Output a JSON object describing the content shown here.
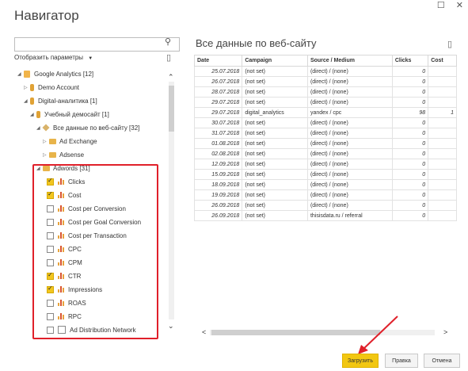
{
  "window": {
    "title": "Навигатор",
    "minimize_glyph": "☐",
    "close_glyph": "✕"
  },
  "left": {
    "search": {
      "value": "",
      "placeholder": ""
    },
    "display_options_label": "Отобразить параметры",
    "tree": [
      {
        "label": "Google Analytics [12]",
        "icon": "google-analytics-icon"
      },
      {
        "label": "Demo Account",
        "icon": "account-icon"
      },
      {
        "label": "Digital-аналитика [1]",
        "icon": "account-icon"
      },
      {
        "label": "Учебный демосайт [1]",
        "icon": "property-icon"
      },
      {
        "label": "Все данные по веб-сайту [32]",
        "icon": "view-cube-icon"
      },
      {
        "label": "Ad Exchange",
        "icon": "folder-icon"
      },
      {
        "label": "Adsense",
        "icon": "folder-icon"
      },
      {
        "label": "Adwords [31]",
        "icon": "folder-icon"
      }
    ],
    "metrics": [
      {
        "label": "Clicks",
        "checked": true
      },
      {
        "label": "Cost",
        "checked": true
      },
      {
        "label": "Cost per Conversion",
        "checked": false
      },
      {
        "label": "Cost per Goal Conversion",
        "checked": false
      },
      {
        "label": "Cost per Transaction",
        "checked": false
      },
      {
        "label": "CPC",
        "checked": false
      },
      {
        "label": "CPM",
        "checked": false
      },
      {
        "label": "CTR",
        "checked": true
      },
      {
        "label": "Impressions",
        "checked": true
      },
      {
        "label": "ROAS",
        "checked": false
      },
      {
        "label": "RPC",
        "checked": false
      },
      {
        "label": "Ad Distribution Network",
        "checked": false
      }
    ]
  },
  "right": {
    "title": "Все данные по веб-сайту",
    "columns": [
      "Date",
      "Campaign",
      "Source / Medium",
      "Clicks",
      "Cost"
    ],
    "rows": [
      [
        "25.07.2018",
        "(not set)",
        "(direct) / (none)",
        "0",
        ""
      ],
      [
        "26.07.2018",
        "(not set)",
        "(direct) / (none)",
        "0",
        ""
      ],
      [
        "28.07.2018",
        "(not set)",
        "(direct) / (none)",
        "0",
        ""
      ],
      [
        "29.07.2018",
        "(not set)",
        "(direct) / (none)",
        "0",
        ""
      ],
      [
        "29.07.2018",
        "digital_analytics",
        "yandex / cpc",
        "98",
        "1"
      ],
      [
        "30.07.2018",
        "(not set)",
        "(direct) / (none)",
        "0",
        ""
      ],
      [
        "31.07.2018",
        "(not set)",
        "(direct) / (none)",
        "0",
        ""
      ],
      [
        "01.08.2018",
        "(not set)",
        "(direct) / (none)",
        "0",
        ""
      ],
      [
        "02.08.2018",
        "(not set)",
        "(direct) / (none)",
        "0",
        ""
      ],
      [
        "12.09.2018",
        "(not set)",
        "(direct) / (none)",
        "0",
        ""
      ],
      [
        "15.09.2018",
        "(not set)",
        "(direct) / (none)",
        "0",
        ""
      ],
      [
        "18.09.2018",
        "(not set)",
        "(direct) / (none)",
        "0",
        ""
      ],
      [
        "19.09.2018",
        "(not set)",
        "(direct) / (none)",
        "0",
        ""
      ],
      [
        "26.09.2018",
        "(not set)",
        "(direct) / (none)",
        "0",
        ""
      ],
      [
        "26.09.2018",
        "(not set)",
        "thisisdata.ru / referral",
        "0",
        ""
      ]
    ]
  },
  "buttons": {
    "load": "Загрузить",
    "edit": "Правка",
    "cancel": "Отмена"
  },
  "colors": {
    "accent": "#f2c711",
    "highlight": "#e0202a"
  }
}
